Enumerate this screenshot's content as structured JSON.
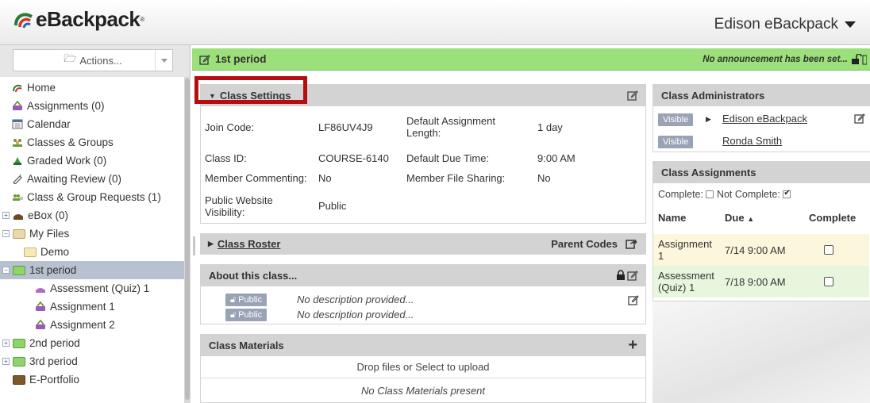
{
  "header": {
    "logo_text": "eBackpack",
    "user_menu_label": "Edison eBackpack"
  },
  "sidebar": {
    "actions_label": "Actions...",
    "items": [
      {
        "label": "Home",
        "icon": "home-icon"
      },
      {
        "label": "Assignments (0)",
        "icon": "assignments-icon"
      },
      {
        "label": "Calendar",
        "icon": "calendar-icon"
      },
      {
        "label": "Classes & Groups",
        "icon": "classes-groups-icon"
      },
      {
        "label": "Graded Work (0)",
        "icon": "graded-work-icon"
      },
      {
        "label": "Awaiting Review (0)",
        "icon": "awaiting-review-icon"
      },
      {
        "label": "Class & Group Requests (1)",
        "icon": "requests-icon"
      },
      {
        "label": "eBox (0)",
        "icon": "ebox-icon"
      },
      {
        "label": "My Files",
        "icon": "folder-icon"
      },
      {
        "label": "Demo",
        "icon": "folder-icon"
      },
      {
        "label": "1st period",
        "icon": "folder-icon",
        "selected": true
      },
      {
        "label": "Assessment (Quiz) 1",
        "icon": "assessment-icon"
      },
      {
        "label": "Assignment 1",
        "icon": "assignment-icon"
      },
      {
        "label": "Assignment 2",
        "icon": "assignment-icon"
      },
      {
        "label": "2nd period",
        "icon": "folder-icon"
      },
      {
        "label": "3rd period",
        "icon": "folder-icon"
      },
      {
        "label": "E-Portfolio",
        "icon": "folder-icon"
      }
    ]
  },
  "banner": {
    "title": "1st period",
    "announcement": "No announcement has been set..."
  },
  "class_settings": {
    "title": "Class Settings",
    "rows": [
      {
        "label": "Join Code:",
        "value": "LF86UV4J9",
        "label2": "Default Assignment Length:",
        "value2": "1 day"
      },
      {
        "label": "Class ID:",
        "value": "COURSE-6140",
        "label2": "Default Due Time:",
        "value2": "9:00 AM"
      },
      {
        "label": "Member Commenting:",
        "value": "No",
        "label2": "Member File Sharing:",
        "value2": "No"
      },
      {
        "label": "Public Website Visibility:",
        "value": "Public"
      }
    ]
  },
  "class_roster": {
    "title": "Class Roster",
    "parent_codes_label": "Parent Codes"
  },
  "about": {
    "title": "About this class...",
    "rows": [
      {
        "badge": "Public",
        "text": "No description provided..."
      },
      {
        "badge": "Public",
        "text": "No description provided..."
      }
    ]
  },
  "materials": {
    "title": "Class Materials",
    "drop_text": "Drop files or Select to upload",
    "empty_text": "No Class Materials present"
  },
  "administrators": {
    "title": "Class Administrators",
    "items": [
      {
        "badge": "Visible",
        "name": "Edison eBackpack"
      },
      {
        "badge": "Visible",
        "name": "Ronda Smith"
      }
    ]
  },
  "assignments": {
    "title": "Class Assignments",
    "filter_complete": "Complete:",
    "filter_not_complete": "Not Complete:",
    "columns": [
      "Name",
      "Due",
      "Complete"
    ],
    "rows": [
      {
        "name": "Assignment 1",
        "due": "7/14 9:00 AM"
      },
      {
        "name": "Assessment (Quiz) 1",
        "due": "7/18 9:00 AM"
      }
    ]
  },
  "colors": {
    "banner_green": "#9be07a",
    "highlight_red": "#b50d10",
    "selected_row": "#b7c1cf"
  }
}
